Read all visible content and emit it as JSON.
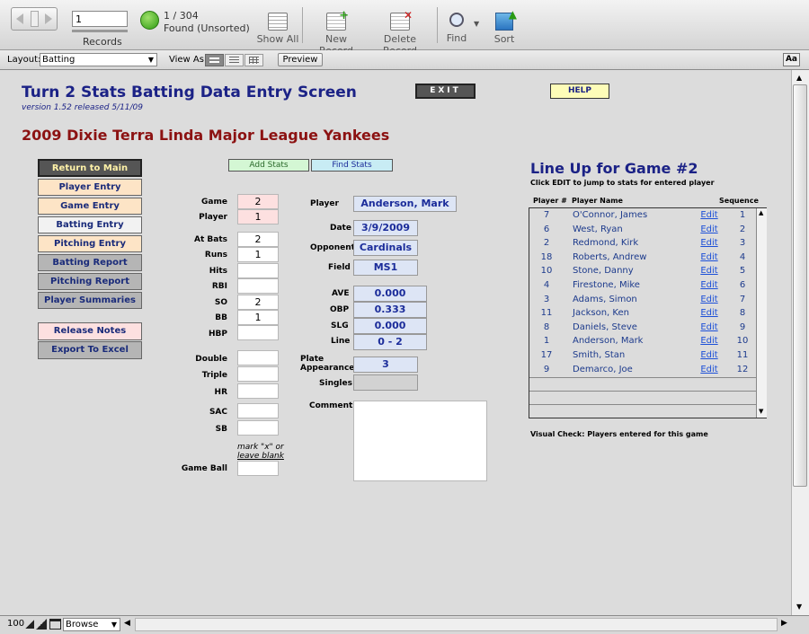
{
  "toolbar": {
    "record_value": "1",
    "records_label": "Records",
    "found_count": "1 / 304",
    "found_status": "Found (Unsorted)",
    "show_all": "Show All",
    "new_record": "New Record",
    "delete_record": "Delete Record",
    "find": "Find",
    "sort": "Sort"
  },
  "layoutbar": {
    "layout_label": "Layout:",
    "layout_value": "Batting",
    "view_as": "View As:",
    "preview": "Preview",
    "aa": "Aa"
  },
  "header": {
    "title": "Turn 2 Stats Batting Data Entry Screen",
    "version": "version 1.52 released 5/11/09",
    "exit": "EXIT",
    "help": "HELP",
    "team": "2009 Dixie Terra Linda Major League Yankees"
  },
  "nav": {
    "return": "Return to Main",
    "player_entry": "Player Entry",
    "game_entry": "Game Entry",
    "batting_entry": "Batting Entry",
    "pitching_entry": "Pitching Entry",
    "batting_report": "Batting Report",
    "pitching_report": "Pitching Report",
    "player_summaries": "Player Summaries",
    "release_notes": "Release Notes",
    "export": "Export To Excel"
  },
  "actions": {
    "add_stats": "Add Stats",
    "find_stats": "Find Stats"
  },
  "stats": {
    "game_label": "Game",
    "game": "2",
    "player_label": "Player",
    "player": "1",
    "at_bats_label": "At Bats",
    "at_bats": "2",
    "runs_label": "Runs",
    "runs": "1",
    "hits_label": "Hits",
    "rbi_label": "RBI",
    "so_label": "SO",
    "so": "2",
    "bb_label": "BB",
    "bb": "1",
    "hbp_label": "HBP",
    "double_label": "Double",
    "triple_label": "Triple",
    "hr_label": "HR",
    "sac_label": "SAC",
    "sb_label": "SB",
    "mark_note": "mark \"x\" or",
    "leave_blank": "leave blank",
    "game_ball_label": "Game Ball"
  },
  "player": {
    "player_label": "Player",
    "player_name": "Anderson, Mark",
    "date_label": "Date",
    "date": "3/9/2009",
    "opponent_label": "Opponent",
    "opponent": "Cardinals",
    "field_label": "Field",
    "field": "MS1",
    "ave_label": "AVE",
    "ave": "0.000",
    "obp_label": "OBP",
    "obp": "0.333",
    "slg_label": "SLG",
    "slg": "0.000",
    "line_label": "Line",
    "line": "0 - 2",
    "pa_label1": "Plate",
    "pa_label2": "Appearances",
    "pa": "3",
    "singles_label": "Singles",
    "comments_label": "Comments"
  },
  "lineup": {
    "title": "Line Up for Game #2",
    "subtitle": "Click EDIT to jump to stats for entered player",
    "col_num": "Player #",
    "col_name": "Player Name",
    "col_seq": "Sequence",
    "rows": [
      {
        "num": "7",
        "name": "O'Connor, James",
        "edit": "Edit",
        "seq": "1"
      },
      {
        "num": "6",
        "name": "West, Ryan",
        "edit": "Edit",
        "seq": "2"
      },
      {
        "num": "2",
        "name": "Redmond, Kirk",
        "edit": "Edit",
        "seq": "3"
      },
      {
        "num": "18",
        "name": "Roberts, Andrew",
        "edit": "Edit",
        "seq": "4"
      },
      {
        "num": "10",
        "name": "Stone, Danny",
        "edit": "Edit",
        "seq": "5"
      },
      {
        "num": "4",
        "name": "Firestone, Mike",
        "edit": "Edit",
        "seq": "6"
      },
      {
        "num": "3",
        "name": "Adams, Simon",
        "edit": "Edit",
        "seq": "7"
      },
      {
        "num": "11",
        "name": "Jackson, Ken",
        "edit": "Edit",
        "seq": "8"
      },
      {
        "num": "8",
        "name": "Daniels, Steve",
        "edit": "Edit",
        "seq": "9"
      },
      {
        "num": "1",
        "name": "Anderson, Mark",
        "edit": "Edit",
        "seq": "10"
      },
      {
        "num": "17",
        "name": "Smith, Stan",
        "edit": "Edit",
        "seq": "11"
      },
      {
        "num": "9",
        "name": "Demarco, Joe",
        "edit": "Edit",
        "seq": "12"
      }
    ],
    "note": "Visual Check: Players entered for this game"
  },
  "statusbar": {
    "zoom": "100",
    "mode": "Browse"
  }
}
